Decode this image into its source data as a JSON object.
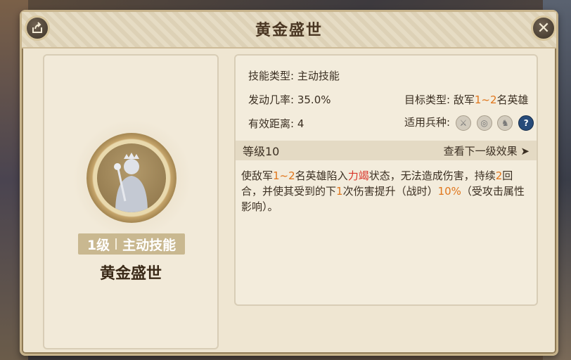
{
  "header": {
    "title": "黄金盛世"
  },
  "left": {
    "level_label": "1级",
    "skill_type": "主动技能",
    "skill_name": "黄金盛世"
  },
  "info": {
    "skill_type_label": "技能类型:",
    "skill_type_value": "主动技能",
    "rate_label": "发动几率:",
    "rate_value": "35.0%",
    "target_label": "目标类型:",
    "target_prefix": "敌军",
    "target_range": "1~2",
    "target_suffix": "名英雄",
    "distance_label": "有效距离:",
    "distance_value": "4",
    "troops_label": "适用兵种:",
    "troop_icons": [
      "sword-icon",
      "target-icon",
      "horse-icon",
      "help-icon"
    ]
  },
  "level_bar": {
    "level": "等级10",
    "next_label": "查看下一级效果 ➤"
  },
  "description": {
    "p1": "使敌军",
    "n1": "1~2",
    "p2": "名英雄陷入",
    "status": "力竭",
    "p3": "状态，无法造成伤害，持续",
    "n2": "2",
    "p4": "回合，并使其受到的下",
    "n3": "1",
    "p5": "次伤害提升（战时）",
    "n4": "10%",
    "p6": "（受攻击属性影响）。"
  },
  "colors": {
    "accent_orange": "#e0761c",
    "accent_red": "#d8352a",
    "panel_bg": "#efe6d2"
  }
}
